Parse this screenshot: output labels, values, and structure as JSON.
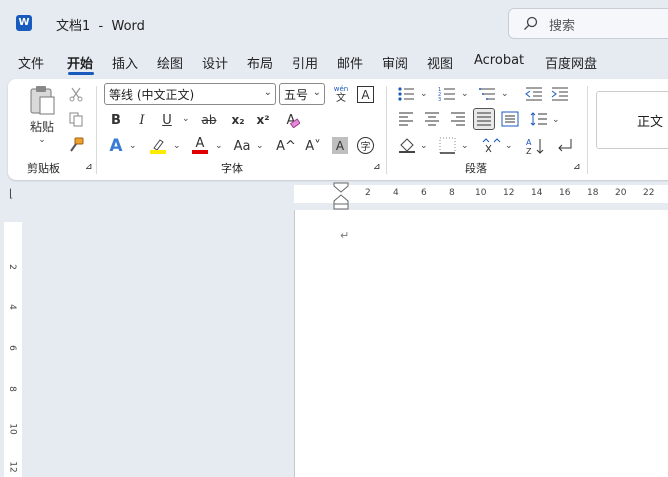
{
  "window": {
    "doc_title": "文档1",
    "app_name": "Word",
    "separator": "-"
  },
  "search": {
    "placeholder": "搜索"
  },
  "tabs": [
    "文件",
    "开始",
    "插入",
    "绘图",
    "设计",
    "布局",
    "引用",
    "邮件",
    "审阅",
    "视图",
    "Acrobat",
    "百度网盘"
  ],
  "active_tab": "开始",
  "clipboard": {
    "paste_label": "粘贴",
    "group_label": "剪贴板"
  },
  "font": {
    "name": "等线 (中文正文)",
    "size": "五号",
    "phonetic_top": "wén",
    "phonetic_bottom": "文",
    "border_char": "A",
    "bold": "B",
    "italic": "I",
    "underline": "U",
    "strike": "ab",
    "subscript": "x₂",
    "superscript": "x²",
    "text_effect": "A",
    "highlight": "A",
    "font_color": "A",
    "change_case": "Aa",
    "grow": "A^",
    "shrink": "A˅",
    "shading": "A",
    "enclose": "字",
    "group_label": "字体"
  },
  "paragraph": {
    "group_label": "段落"
  },
  "styles": {
    "normal": "正文"
  },
  "ruler": {
    "h_ticks": [
      "2",
      "4",
      "6",
      "8",
      "10",
      "12",
      "14",
      "16",
      "18",
      "20",
      "22"
    ],
    "v_ticks": [
      "2",
      "4",
      "6",
      "8",
      "10",
      "12"
    ]
  },
  "colors": {
    "accent": "#185abd",
    "highlight": "#ffeb00",
    "font_red": "#e00000"
  }
}
